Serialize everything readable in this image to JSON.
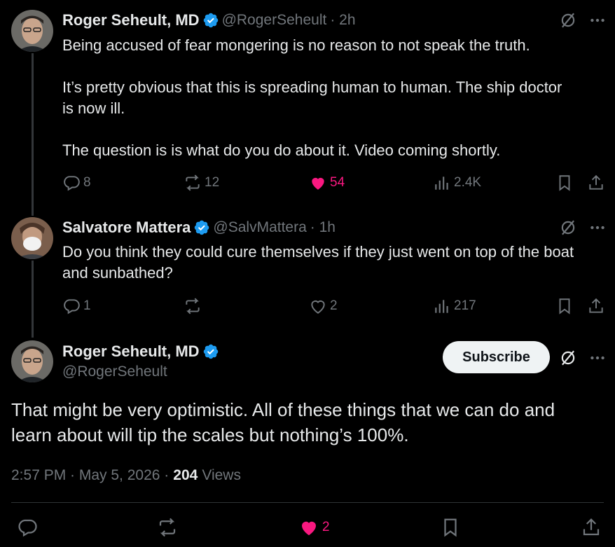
{
  "tweet1": {
    "name": "Roger Seheult, MD",
    "handle": "@RogerSeheult",
    "time": "· 2h",
    "lines": [
      "Being accused of fear mongering is no reason to not speak the truth.",
      "It’s pretty obvious that this is spreading human to human.  The ship doctor",
      "is now ill.",
      "The question is is what do you do about it. Video coming shortly."
    ],
    "replies": "8",
    "reposts": "12",
    "likes": "54",
    "views": "2.4K"
  },
  "tweet2": {
    "name": "Salvatore Mattera",
    "handle": "@SalvMattera",
    "time": "· 1h",
    "lines": [
      "Do you think they could cure themselves if they just went on top of the boat",
      "and sunbathed?"
    ],
    "replies": "1",
    "likes": "2",
    "views": "217"
  },
  "main_tweet": {
    "name": "Roger Seheult, MD",
    "handle": "@RogerSeheult",
    "subscribe_label": "Subscribe",
    "lines": [
      "That might be very optimistic. All of these things that we can do and",
      "learn about will tip the scales but nothing’s 100%."
    ],
    "timestamp": "2:57 PM · May 5, 2026 ·",
    "views_count": "204",
    "views_label": "Views",
    "likes": "2"
  },
  "colors": {
    "background": "#000000",
    "text": "#e7e9ea",
    "muted": "#71767b",
    "verified": "#1d9bf0",
    "like": "#f91880"
  }
}
